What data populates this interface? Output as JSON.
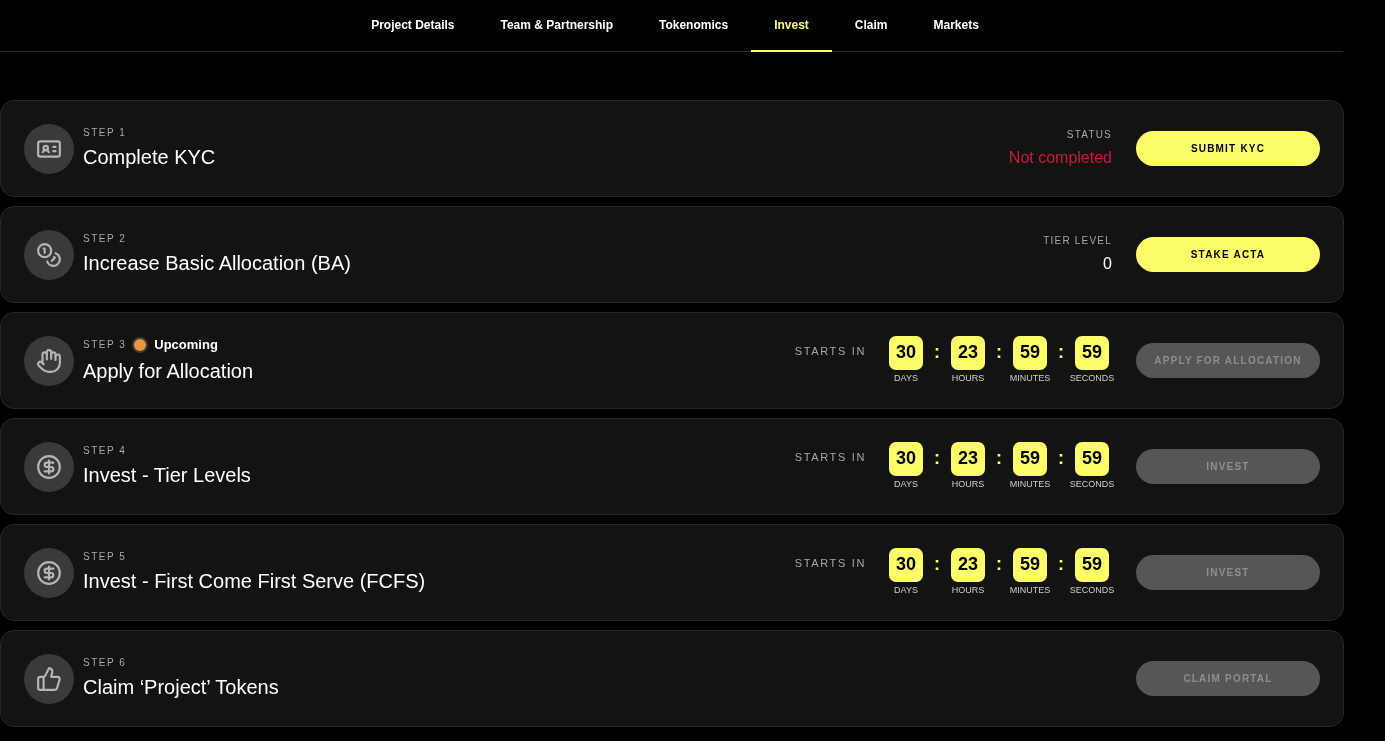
{
  "tabs": [
    {
      "label": "Project Details",
      "selected": false
    },
    {
      "label": "Team & Partnership",
      "selected": false
    },
    {
      "label": "Tokenomics",
      "selected": false
    },
    {
      "label": "Invest",
      "selected": true
    },
    {
      "label": "Claim",
      "selected": false
    },
    {
      "label": "Markets",
      "selected": false
    }
  ],
  "steps": [
    {
      "step": "STEP 1",
      "title": "Complete KYC",
      "kind": "status",
      "info_label": "STATUS",
      "info_value": "Not completed",
      "color": "#d0163f",
      "button": {
        "label": "SUBMIT KYC",
        "disabled": false
      }
    },
    {
      "step": "STEP 2",
      "title": "Increase Basic Allocation (BA)",
      "kind": "status",
      "info_label": "TIER LEVEL",
      "info_value": "0",
      "color": "#ffffff",
      "button": {
        "label": "STAKE ACTA",
        "disabled": false
      }
    },
    {
      "step": "STEP 3",
      "badge": {
        "label": "Upcoming",
        "color": "#e8973f"
      },
      "title": "Apply for Allocation",
      "kind": "countdown",
      "countdown_label": "STARTS IN",
      "units": [
        {
          "value": "30",
          "label": "DAYS"
        },
        {
          "value": "23",
          "label": "HOURS"
        },
        {
          "value": "59",
          "label": "MINUTES"
        },
        {
          "value": "59",
          "label": "SECONDS"
        }
      ],
      "separator": ":",
      "button": {
        "label": "APPLY FOR ALLOCATION",
        "disabled": true
      }
    },
    {
      "step": "STEP 4",
      "title": "Invest - Tier Levels",
      "kind": "countdown",
      "countdown_label": "STARTS IN",
      "units": [
        {
          "value": "30",
          "label": "DAYS"
        },
        {
          "value": "23",
          "label": "HOURS"
        },
        {
          "value": "59",
          "label": "MINUTES"
        },
        {
          "value": "59",
          "label": "SECONDS"
        }
      ],
      "separator": ":",
      "button": {
        "label": "INVEST",
        "disabled": true
      }
    },
    {
      "step": "STEP 5",
      "title": "Invest - First Come First Serve (FCFS)",
      "kind": "countdown",
      "countdown_label": "STARTS IN",
      "units": [
        {
          "value": "30",
          "label": "DAYS"
        },
        {
          "value": "23",
          "label": "HOURS"
        },
        {
          "value": "59",
          "label": "MINUTES"
        },
        {
          "value": "59",
          "label": "SECONDS"
        }
      ],
      "separator": ":",
      "button": {
        "label": "INVEST",
        "disabled": true
      }
    },
    {
      "step": "STEP 6",
      "title": "Claim ‘Project’ Tokens",
      "kind": "none",
      "button": {
        "label": "CLAIM PORTAL",
        "disabled": true
      }
    }
  ]
}
